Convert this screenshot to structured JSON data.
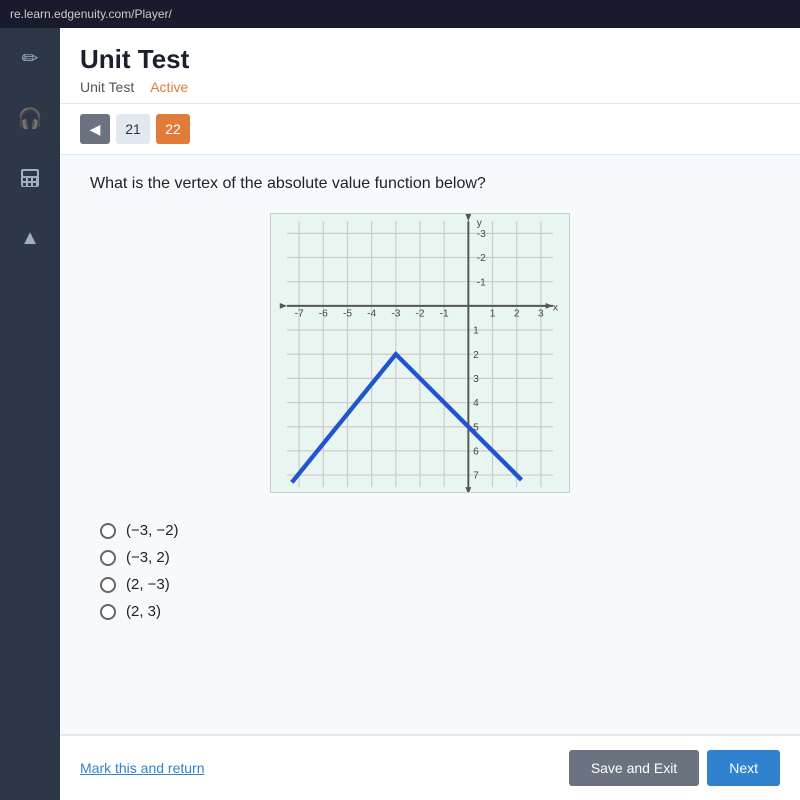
{
  "browser": {
    "url": "re.learn.edgenuity.com/Player/"
  },
  "header": {
    "title": "Unit Test",
    "breadcrumb_item": "Unit Test",
    "breadcrumb_status": "Active"
  },
  "navigation": {
    "prev_btn": "◀",
    "pages": [
      {
        "number": "21",
        "active": false
      },
      {
        "number": "22",
        "active": true
      }
    ]
  },
  "question": {
    "text": "What is the vertex of the absolute value function below?"
  },
  "answer_choices": [
    {
      "label": "(−3, −2)"
    },
    {
      "label": "(−3, 2)"
    },
    {
      "label": "(2, −3)"
    },
    {
      "label": "(2, 3)"
    }
  ],
  "footer": {
    "mark_return": "Mark this and return",
    "save_exit": "Save and Exit",
    "next": "Next"
  },
  "sidebar_icons": [
    {
      "name": "pencil",
      "symbol": "✏"
    },
    {
      "name": "headphones",
      "symbol": "🎧"
    },
    {
      "name": "calculator",
      "symbol": "⬛"
    },
    {
      "name": "up-arrow",
      "symbol": "▲"
    }
  ]
}
